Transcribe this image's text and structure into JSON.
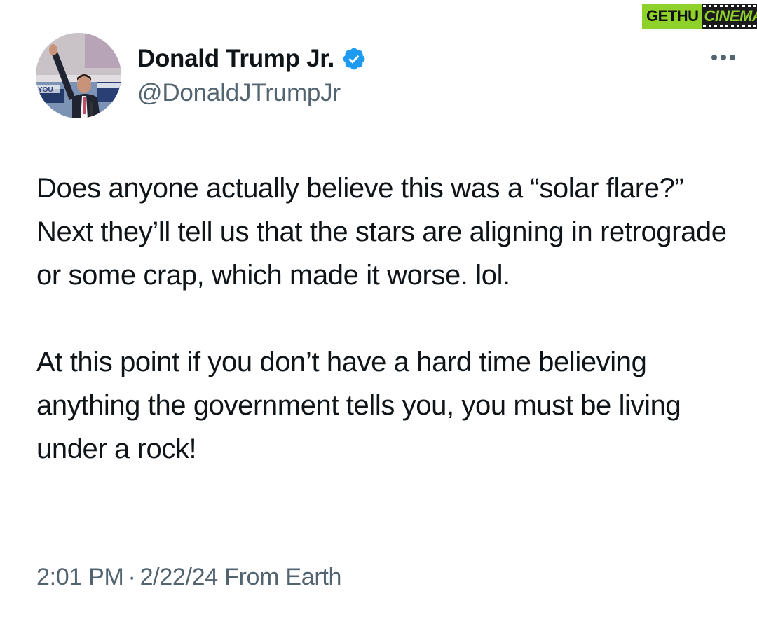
{
  "watermark": {
    "left_text": "GETHU",
    "right_text": "CINEMA",
    "colors": {
      "green": "#8fd12b",
      "dark": "#1b1b1b"
    }
  },
  "author": {
    "display_name": "Donald Trump Jr.",
    "handle": "@DonaldJTrumpJr",
    "verified": true,
    "verified_color": "#1d9bf0",
    "avatar_icon": "profile-photo"
  },
  "more_icon": "ellipsis-icon",
  "tweet": {
    "paragraphs": [
      "Does anyone actually believe this was a “solar flare?” Next they’ll tell us that the stars are aligning in retrograde or some crap, which made it worse. lol.",
      "At this point if you don’t have a hard time believing anything the government tells you, you must be living under a rock!"
    ],
    "time": "2:01 PM",
    "separator": "·",
    "date": "2/22/24",
    "source": "From Earth"
  },
  "colors": {
    "text_primary": "#0f1419",
    "text_secondary": "#536471",
    "divider": "#cfd9de"
  }
}
